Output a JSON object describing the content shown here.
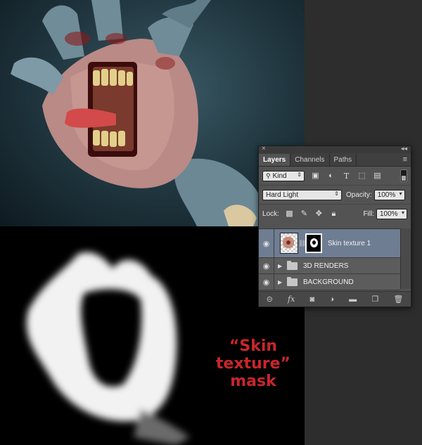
{
  "panel": {
    "close_glyph": "×",
    "collapse_glyph": "◂◂",
    "tabs": [
      {
        "label": "Layers",
        "active": true
      },
      {
        "label": "Channels",
        "active": false
      },
      {
        "label": "Paths",
        "active": false
      }
    ],
    "menu_glyph": "≡",
    "filter": {
      "label": "Kind",
      "icons": [
        "image-filter-icon",
        "adjustment-filter-icon",
        "type-filter-icon",
        "shape-filter-icon",
        "smart-object-filter-icon"
      ]
    },
    "blend_mode": "Hard Light",
    "opacity_label": "Opacity:",
    "opacity_value": "100%",
    "lock_label": "Lock:",
    "fill_label": "Fill:",
    "fill_value": "100%",
    "layers": [
      {
        "name": "Skin texture 1",
        "type": "layer",
        "selected": true,
        "visible": true
      },
      {
        "name": "3D RENDERS",
        "type": "group",
        "selected": false,
        "visible": true
      },
      {
        "name": "BACKGROUND",
        "type": "group",
        "selected": false,
        "visible": true
      }
    ],
    "bottom_icons": [
      "link-layers-icon",
      "fx-icon",
      "add-mask-icon",
      "adjustment-layer-icon",
      "new-group-icon",
      "new-layer-icon",
      "trash-icon"
    ]
  },
  "caption": {
    "line1": "“Skin",
    "line2": "texture”",
    "line3": "mask"
  },
  "colors": {
    "caption": "#c8262b",
    "selected_layer": "#6f7d93",
    "panel_bg": "#535353"
  }
}
